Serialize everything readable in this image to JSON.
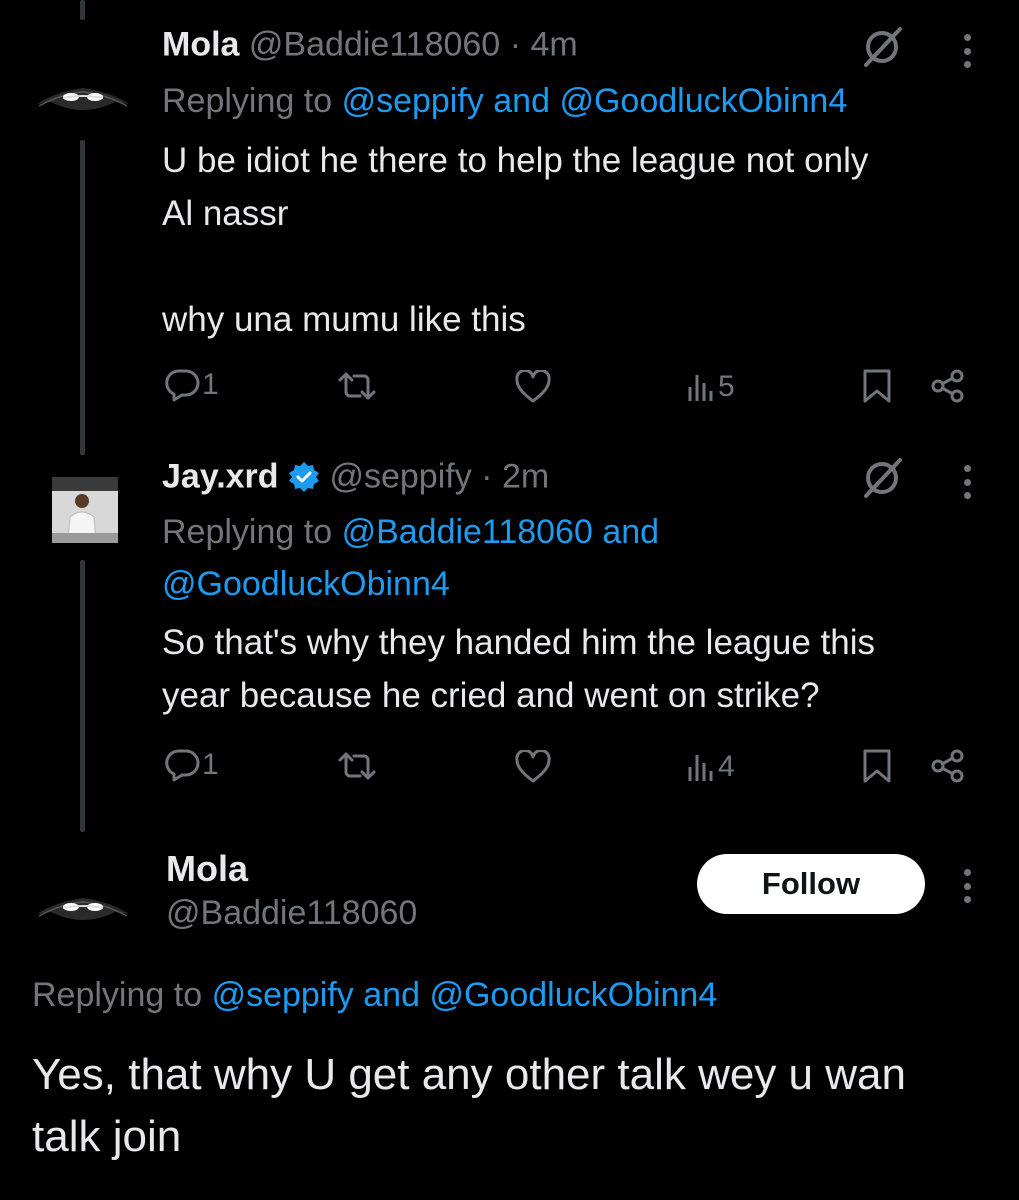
{
  "tweet1": {
    "name": "Mola",
    "handle": "@Baddie118060",
    "time": "· 4m",
    "replying_prefix": "Replying to",
    "replying_to_1": "@seppify",
    "replying_and": "and",
    "replying_to_2": "@GoodluckObinn4",
    "text": "U be idiot he there to help the league not only\nAl nassr\n\nwhy una mumu like this",
    "replies": "1",
    "views": "5"
  },
  "tweet2": {
    "name": "Jay.xrd",
    "handle": "@seppify",
    "time": "· 2m",
    "replying_prefix": "Replying to",
    "replying_to_1": "@Baddie118060 and",
    "replying_to_2": "@GoodluckObinn4",
    "text": "So that's why they handed him the league this\nyear because he cried and went on strike?",
    "replies": "1",
    "views": "4"
  },
  "main_tweet": {
    "name": "Mola",
    "handle": "@Baddie118060",
    "follow_label": "Follow",
    "replying_prefix": "Replying to",
    "replying_to_1": "@seppify",
    "replying_and": "and",
    "replying_to_2": "@GoodluckObinn4",
    "text": "Yes, that why U get any other talk wey u wan\ntalk join"
  },
  "icons": {
    "grok": "grok-icon",
    "more": "more-icon",
    "reply": "reply-icon",
    "retweet": "retweet-icon",
    "like": "heart-icon",
    "views": "views-icon",
    "bookmark": "bookmark-icon",
    "share": "share-icon",
    "verified": "verified-badge-icon"
  },
  "colors": {
    "background": "#000000",
    "text": "#e7e9ea",
    "muted": "#71767b",
    "link": "#1d9bf0",
    "verified": "#1d9bf0"
  }
}
